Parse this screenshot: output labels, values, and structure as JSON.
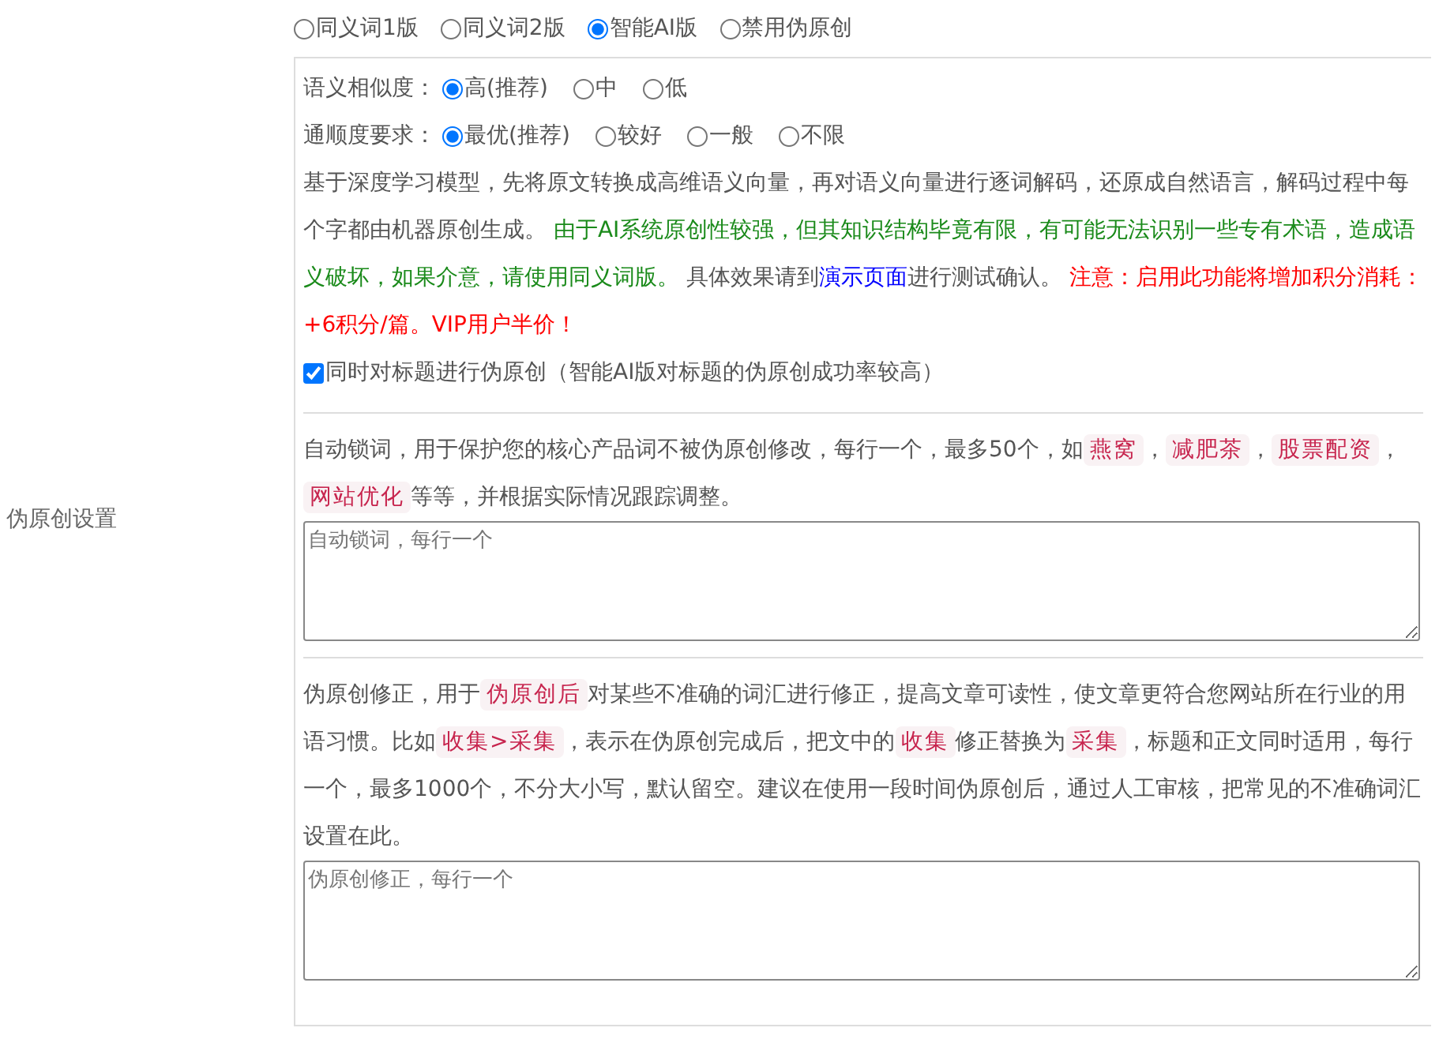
{
  "side_label": "伪原创设置",
  "modes": [
    {
      "label": "同义词1版",
      "selected": false
    },
    {
      "label": "同义词2版",
      "selected": false
    },
    {
      "label": "智能AI版",
      "selected": true
    },
    {
      "label": "禁用伪原创",
      "selected": false
    }
  ],
  "option_groups": [
    {
      "label": "语义相似度：",
      "options": [
        {
          "label": "高(推荐)",
          "selected": true
        },
        {
          "label": "中",
          "selected": false
        },
        {
          "label": "低",
          "selected": false
        }
      ]
    },
    {
      "label": "通顺度要求：",
      "options": [
        {
          "label": "最优(推荐)",
          "selected": true
        },
        {
          "label": "较好",
          "selected": false
        },
        {
          "label": "一般",
          "selected": false
        },
        {
          "label": "不限",
          "selected": false
        }
      ]
    }
  ],
  "ai_description": [
    {
      "kind": "text",
      "text": "基于深度学习模型，先将原文转换成高维语义向量，再对语义向量进行逐词解码，还原成自然语言，解码过程中每个字都由机器原创生成。 "
    },
    {
      "kind": "notice",
      "text": "由于AI系统原创性较强，但其知识结构毕竟有限，有可能无法识别一些专有术语，造成语义破坏，如果介意，请使用同义词版。"
    },
    {
      "kind": "text",
      "text": " 具体效果请到"
    },
    {
      "kind": "link",
      "text": "演示页面"
    },
    {
      "kind": "text",
      "text": "进行测试确认。 "
    },
    {
      "kind": "warning",
      "text": "注意：启用此功能将增加积分消耗：+6积分/篇。VIP用户半价！"
    }
  ],
  "title_option": {
    "label": "同时对标题进行伪原创（智能AI版对标题的伪原创成功率较高）",
    "checked": true
  },
  "lock_words": {
    "description": [
      {
        "kind": "text",
        "text": "自动锁词，用于保护您的核心产品词不被伪原创修改，每行一个，最多50个，如"
      },
      {
        "kind": "code",
        "text": "燕窝"
      },
      {
        "kind": "text",
        "text": "，"
      },
      {
        "kind": "code",
        "text": "减肥茶"
      },
      {
        "kind": "text",
        "text": "，"
      },
      {
        "kind": "code",
        "text": "股票配资"
      },
      {
        "kind": "text",
        "text": "，"
      },
      {
        "kind": "code",
        "text": "网站优化"
      },
      {
        "kind": "text",
        "text": "等等，并根据实际情况跟踪调整。"
      }
    ],
    "placeholder": "自动锁词，每行一个"
  },
  "correction": {
    "description": [
      {
        "kind": "text",
        "text": "伪原创修正，用于"
      },
      {
        "kind": "code",
        "text": "伪原创后"
      },
      {
        "kind": "text",
        "text": "对某些不准确的词汇进行修正，提高文章可读性，使文章更符合您网站所在行业的用语习惯。比如"
      },
      {
        "kind": "code",
        "text": "收集>采集"
      },
      {
        "kind": "text",
        "text": "，表示在伪原创完成后，把文中的"
      },
      {
        "kind": "code",
        "text": "收集"
      },
      {
        "kind": "text",
        "text": "修正替换为"
      },
      {
        "kind": "code",
        "text": "采集"
      },
      {
        "kind": "text",
        "text": "，标题和正文同时适用，每行一个，最多1000个，不分大小写，默认留空。建议在使用一段时间伪原创后，通过人工审核，把常见的不准确词汇设置在此。"
      }
    ],
    "placeholder": "伪原创修正，每行一个"
  }
}
